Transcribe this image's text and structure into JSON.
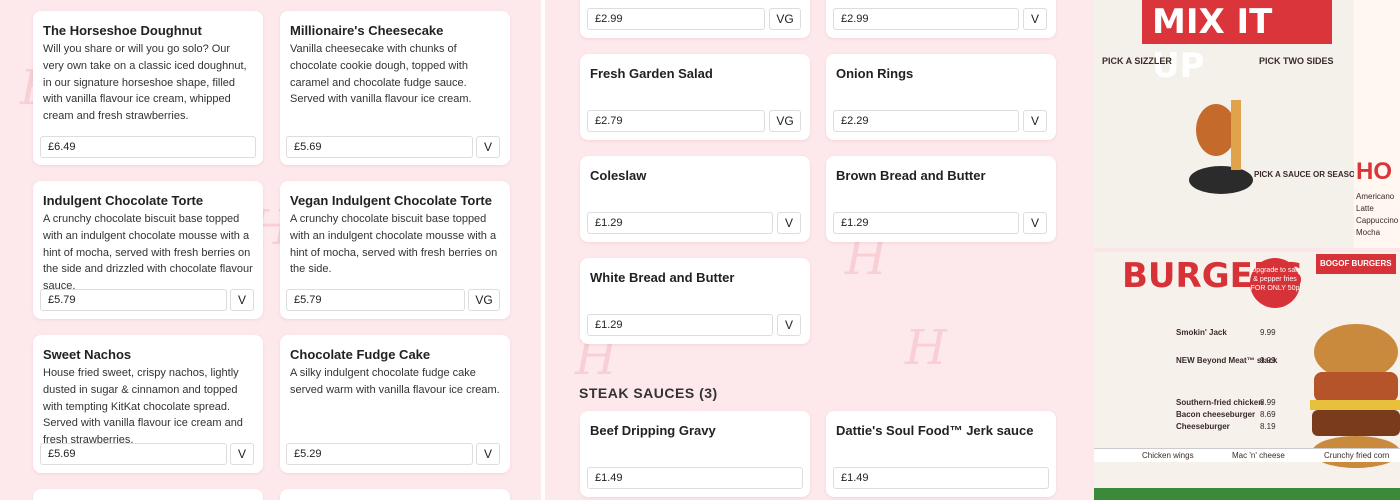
{
  "left_cards": [
    {
      "title": "The Horseshoe Doughnut",
      "desc": "Will you share or will you go solo? Our very own take on a classic iced doughnut, in our signature horseshoe shape, filled with vanilla flavour ice cream, whipped cream and fresh strawberries.",
      "price": "£6.49",
      "tag": ""
    },
    {
      "title": "Millionaire's Cheesecake",
      "desc": "Vanilla cheesecake with chunks of chocolate cookie dough, topped with caramel and chocolate fudge sauce. Served with vanilla flavour ice cream.",
      "price": "£5.69",
      "tag": "V"
    },
    {
      "title": "Indulgent Chocolate Torte",
      "desc": "A crunchy chocolate biscuit base topped with an indulgent chocolate mousse with a hint of mocha, served with fresh berries on the side and drizzled with chocolate flavour sauce.",
      "price": "£5.79",
      "tag": "V"
    },
    {
      "title": "Vegan Indulgent Chocolate Torte",
      "desc": "A crunchy chocolate biscuit base topped with an indulgent chocolate mousse with a hint of mocha, served with fresh berries on the side.",
      "price": "£5.79",
      "tag": "VG"
    },
    {
      "title": "Sweet Nachos",
      "desc": "House fried sweet, crispy nachos, lightly dusted in sugar & cinnamon and topped with tempting KitKat chocolate spread. Served with vanilla flavour ice cream and fresh strawberries.",
      "price": "£5.69",
      "tag": "V"
    },
    {
      "title": "Chocolate Fudge Cake",
      "desc": "A silky indulgent chocolate fudge cake served warm with vanilla flavour ice cream.",
      "price": "£5.29",
      "tag": "V"
    }
  ],
  "mid_cards": [
    {
      "title": "",
      "price": "£2.99",
      "tag": "VG"
    },
    {
      "title": "",
      "price": "£2.99",
      "tag": "V"
    },
    {
      "title": "Fresh Garden Salad",
      "price": "£2.79",
      "tag": "VG"
    },
    {
      "title": "Onion Rings",
      "price": "£2.29",
      "tag": "V"
    },
    {
      "title": "Coleslaw",
      "price": "£1.29",
      "tag": "V"
    },
    {
      "title": "Brown Bread and Butter",
      "price": "£1.29",
      "tag": "V"
    },
    {
      "title": "White Bread and Butter",
      "price": "£1.29",
      "tag": "V"
    }
  ],
  "steak_sauces": {
    "heading": "STEAK SAUCES (3)",
    "items": [
      {
        "title": "Beef Dripping Gravy",
        "price": "£1.49"
      },
      {
        "title": "Dattie's Soul Food™ Jerk sauce",
        "price": "£1.49"
      }
    ]
  },
  "photos": {
    "top_title": "MIX IT UP",
    "top_lines": [
      "PICK A SIZZLER",
      "PICK TWO SIDES",
      "PICK A SAUCE OR SEASONING",
      "Americano",
      "Latte",
      "Cappuccino",
      "Mocha"
    ],
    "top_hot": "HO",
    "bottom_title": "BURGERS",
    "bottom_promo": "BOGOF BURGERS",
    "bottom_lines": [
      "Smokin' Jack",
      "NEW Beyond Meat™ stack",
      "Southern-fried chicken",
      "Bacon cheeseburger",
      "Cheeseburger",
      "Chicken wings",
      "Mac 'n' cheese",
      "Crunchy fried corn"
    ],
    "bottom_prices": [
      "9.99",
      "9.99",
      "8.99",
      "8.69",
      "8.19"
    ],
    "bottom_upgrade": "Upgrade to salt & pepper fries FOR ONLY 50p"
  },
  "colors": {
    "accent": "#d9353a",
    "bg": "#fde9ec"
  }
}
